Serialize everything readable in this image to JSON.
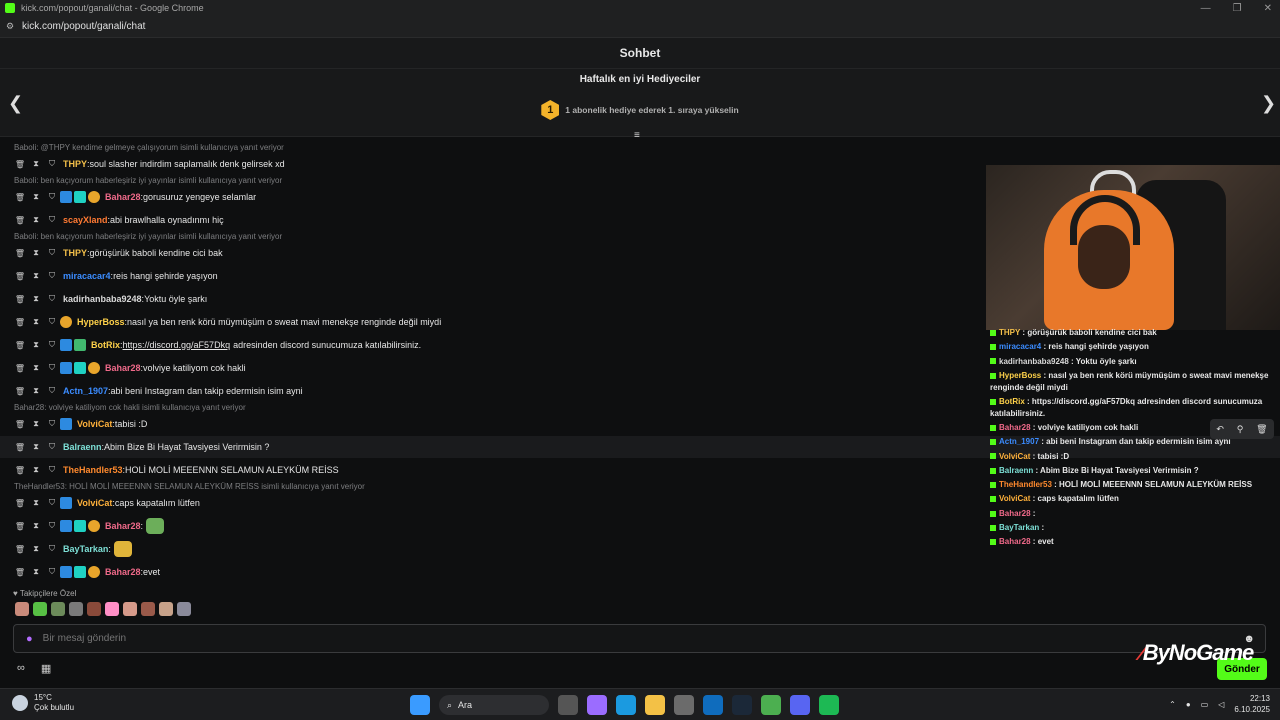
{
  "window": {
    "title": "kick.com/popout/ganali/chat - Google Chrome",
    "url": "kick.com/popout/ganali/chat"
  },
  "header": {
    "title": "Sohbet"
  },
  "gifters": {
    "title": "Haftalık en iyi Hediyeciler",
    "rank_badge": "1",
    "subtitle": "1 abonelik hediye ederek 1. sıraya yükselin"
  },
  "colors": {
    "kick_green": "#53fc18",
    "accent_purple": "#b36cff"
  },
  "messages": [
    {
      "reply": "Baboli: @THPY kendime gelmeye çalışıyorum isimli kullanıcıya yanıt veriyor",
      "user": "THPY",
      "color": "#f4c04a",
      "text": "soul slasher indirdim saplamalık denk gelirsek xd",
      "badges": []
    },
    {
      "reply": "Baboli: ben kaçıyorum haberleşiriz iyi yayınlar isimli kullanıcıya yanıt veriyor",
      "user": "Bahar28",
      "color": "#f06a8a",
      "text": "gorusuruz yengeye selamlar",
      "badges": [
        "b",
        "t",
        "y"
      ]
    },
    {
      "reply": "",
      "user": "scayXland",
      "color": "#ff7a33",
      "text": "abi brawlhalla oynadınmı hiç",
      "badges": []
    },
    {
      "reply": "Baboli: ben kaçıyorum haberleşiriz iyi yayınlar isimli kullanıcıya yanıt veriyor",
      "user": "THPY",
      "color": "#f4c04a",
      "text": "görüşürük baboli kendine cici bak",
      "badges": []
    },
    {
      "reply": "",
      "user": "miracacar4",
      "color": "#3b8cff",
      "text": "reis hangi şehirde yaşıyon",
      "badges": []
    },
    {
      "reply": "",
      "user": "kadirhanbaba9248",
      "color": "#d9d9d9",
      "text": "Yoktu öyle şarkı",
      "badges": []
    },
    {
      "reply": "",
      "user": "HyperBoss",
      "color": "#ffd24a",
      "text": "nasıl ya ben renk körü müymüşüm o sweat mavi menekşe renginde değil miydi",
      "badges": [
        "y"
      ]
    },
    {
      "reply": "",
      "user": "BotRix",
      "color": "#ffd24a",
      "text": "https://discord.gg/aF57Dkq",
      "text2": "adresinden discord sunucumuza katılabilirsiniz.",
      "badges": [
        "b",
        "g"
      ]
    },
    {
      "reply": "",
      "user": "Bahar28",
      "color": "#f06a8a",
      "text": "volviye katiliyom cok hakli",
      "badges": [
        "b",
        "t",
        "y"
      ]
    },
    {
      "reply": "",
      "user": "Actn_1907",
      "color": "#3b8cff",
      "text": "abi beni Instagram dan takip edermisin isim ayni",
      "badges": []
    },
    {
      "reply": "Bahar28: volviye katiliyom cok hakli isimli kullanıcıya yanıt veriyor",
      "user": "VolviCat",
      "color": "#ffb13b",
      "text": "tabisi :D",
      "badges": [
        "b"
      ]
    },
    {
      "reply": "",
      "user": "Balraenn",
      "color": "#7de0d6",
      "text": "Abim Bize Bi Hayat Tavsiyesi Verirmisin ?",
      "badges": []
    },
    {
      "reply": "",
      "user": "TheHandler53",
      "color": "#ff8a2e",
      "text": "HOLİ MOLİ MEEENNN SELAMUN ALEYKÜM REİSS",
      "badges": []
    },
    {
      "reply": "TheHandler53: HOLİ MOLİ MEEENNN SELAMUN ALEYKÜM REİSS isimli kullanıcıya yanıt veriyor",
      "user": "VolviCat",
      "color": "#ffb13b",
      "text": "caps kapatalım lütfen",
      "badges": [
        "b"
      ]
    },
    {
      "reply": "",
      "user": "Bahar28",
      "color": "#f06a8a",
      "text": "",
      "badges": [
        "b",
        "t",
        "y"
      ],
      "emote": "#6cae5a"
    },
    {
      "reply": "",
      "user": "BayTarkan",
      "color": "#7de0d6",
      "text": "",
      "badges": [],
      "emote": "#e0b53a"
    },
    {
      "reply": "",
      "user": "Bahar28",
      "color": "#f06a8a",
      "text": "evet",
      "badges": [
        "b",
        "t",
        "y"
      ]
    }
  ],
  "followers_only": {
    "label": "Takipçilere Özel"
  },
  "input": {
    "placeholder": "Bir mesaj gönderin"
  },
  "send_button": {
    "label": "Gönder"
  },
  "overlay": {
    "lines": [
      {
        "user": "THPY",
        "color": "#f4c04a",
        "text": "görüşürük baboli kendine cici bak"
      },
      {
        "user": "miracacar4",
        "color": "#3b8cff",
        "text": "reis hangi şehirde yaşıyon"
      },
      {
        "user": "kadirhanbaba9248",
        "color": "#d9d9d9",
        "text": "Yoktu öyle şarkı"
      },
      {
        "user": "HyperBoss",
        "color": "#ffd24a",
        "text": "nasıl ya ben renk körü müymüşüm o sweat mavi menekşe renginde değil miydi"
      },
      {
        "user": "BotRix",
        "color": "#ffd24a",
        "text": "https://discord.gg/aF57Dkq adresinden discord sunucumuza katılabilirsiniz."
      },
      {
        "user": "Bahar28",
        "color": "#f06a8a",
        "text": "volviye katiliyom cok hakli"
      },
      {
        "user": "Actn_1907",
        "color": "#3b8cff",
        "text": "abi beni Instagram dan takip edermisin isim ayni"
      },
      {
        "user": "VolviCat",
        "color": "#ffb13b",
        "text": "tabisi :D"
      },
      {
        "user": "Balraenn",
        "color": "#7de0d6",
        "text": "Abim Bize Bi Hayat Tavsiyesi Verirmisin ?"
      },
      {
        "user": "TheHandler53",
        "color": "#ff8a2e",
        "text": "HOLİ MOLİ MEEENNN SELAMUN ALEYKÜM REİSS"
      },
      {
        "user": "VolviCat",
        "color": "#ffb13b",
        "text": "caps kapatalım lütfen"
      },
      {
        "user": "Bahar28",
        "color": "#f06a8a",
        "text": ""
      },
      {
        "user": "BayTarkan",
        "color": "#7de0d6",
        "text": ""
      },
      {
        "user": "Bahar28",
        "color": "#f06a8a",
        "text": "evet"
      }
    ]
  },
  "watermark": {
    "text": "ByNoGame"
  },
  "taskbar": {
    "temp": "15°C",
    "weather": "Çok bulutlu",
    "search": "Ara",
    "time": "22:13",
    "date": "6.10.2025"
  }
}
